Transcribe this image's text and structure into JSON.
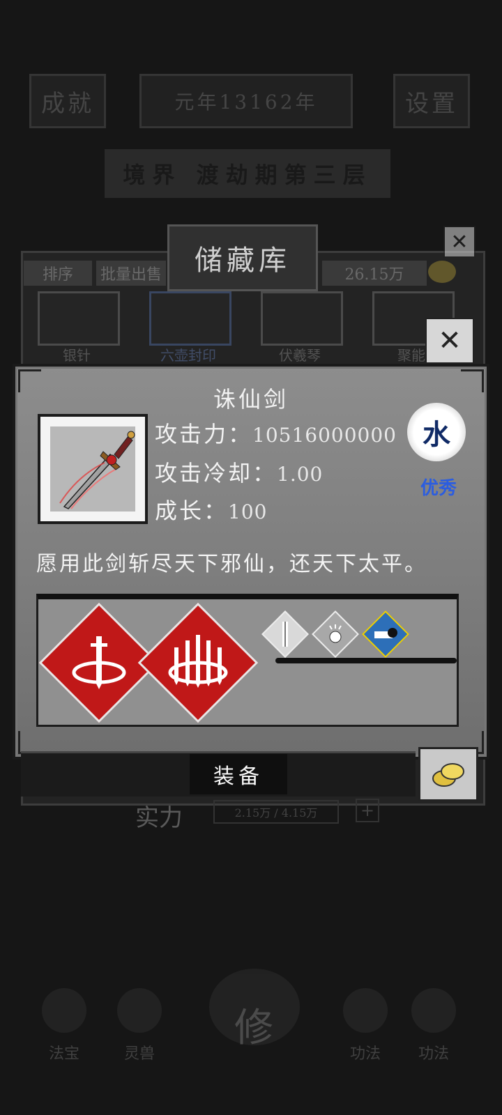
{
  "background": {
    "top_left_label": "成就",
    "year_label": "元年13162年",
    "settings_label": "设置",
    "realm_banner": "境界 渡劫期第三层",
    "storage_title": "储藏库",
    "sort_tab": "排序",
    "batch_sell_tab": "批量出售",
    "currency_amount": "26.15万",
    "slot_labels": [
      "银针",
      "六壶封印",
      "伏羲琴",
      "聚能"
    ],
    "power_label": "实力",
    "power_value": "2.15万 / 4.15万",
    "nav_items": [
      "法宝",
      "灵兽",
      "修",
      "功法",
      "功法"
    ]
  },
  "dialog": {
    "item_name": "诛仙剑",
    "attack_label": "攻击力：",
    "attack_value": "10516000000",
    "cooldown_label": "攻击冷却：",
    "cooldown_value": "1.00",
    "growth_label": "成长：",
    "growth_value": "100",
    "element": "水",
    "quality": "优秀",
    "description": "愿用此剑斩尽天下邪仙，还天下太平。",
    "equip_label": "装备"
  },
  "colors": {
    "skill_red": "#c01818",
    "element_text": "#102a66",
    "quality_blue": "#2b5de0"
  },
  "icons": [
    "close-icon",
    "coin-icon",
    "sword-ring-skill-icon",
    "multi-sword-ring-skill-icon",
    "down-arrow-buff-icon",
    "cat-buff-icon",
    "shoe-speed-buff-icon"
  ]
}
